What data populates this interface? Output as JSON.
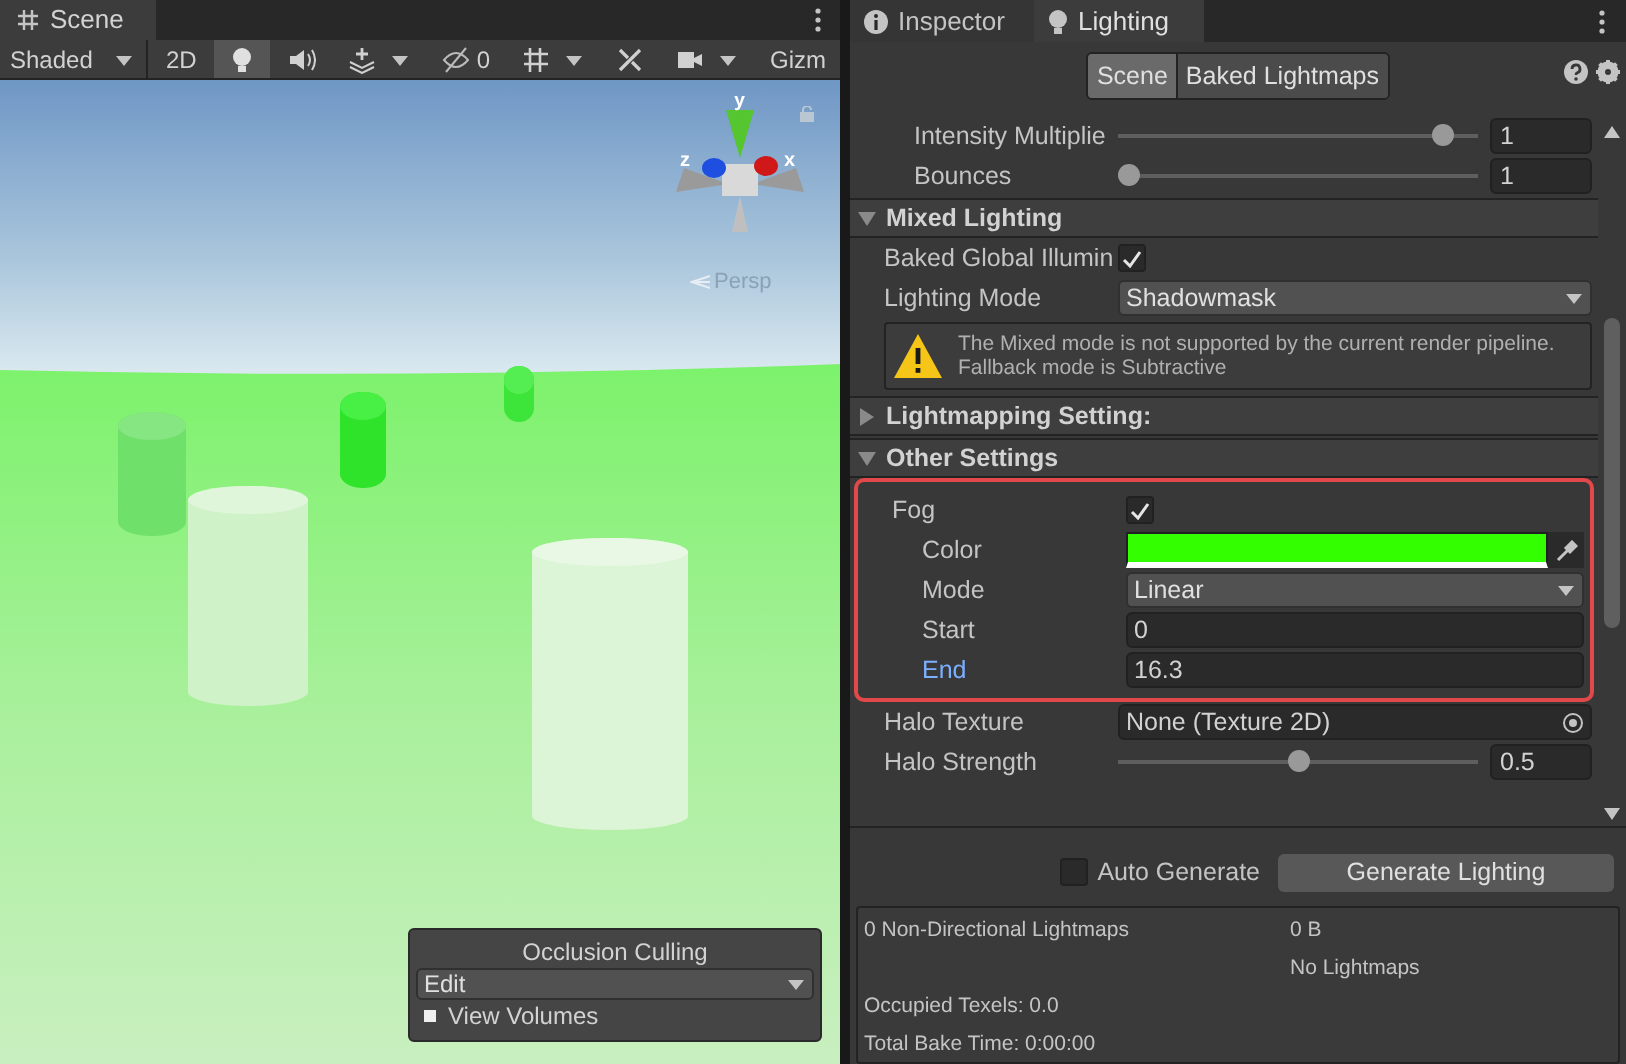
{
  "scene": {
    "tab": "Scene",
    "shading": "Shaded",
    "toolbar": [
      {
        "kind": "text",
        "label": "2D",
        "on": false
      },
      {
        "kind": "bulb",
        "on": true
      },
      {
        "kind": "speaker",
        "on": false
      },
      {
        "kind": "layers",
        "on": false,
        "caret": true
      },
      {
        "kind": "hidden",
        "label": "0",
        "on": false
      },
      {
        "kind": "grid",
        "on": false,
        "caret": true
      },
      {
        "kind": "tools",
        "on": false
      },
      {
        "kind": "camera",
        "on": false,
        "caret": true
      },
      {
        "kind": "text",
        "label": "Gizm",
        "on": false
      }
    ],
    "gizmo": {
      "y": "y",
      "x": "x",
      "z": "z"
    },
    "projection": "Persp",
    "occlusion": {
      "title": "Occlusion Culling",
      "mode": "Edit",
      "view_volumes": {
        "label": "View Volumes",
        "checked": true
      }
    }
  },
  "lighting": {
    "tabs": [
      {
        "label": "Inspector",
        "selected": false
      },
      {
        "label": "Lighting",
        "selected": true
      }
    ],
    "subtabs": [
      {
        "label": "Scene",
        "selected": true
      },
      {
        "label": "Baked Lightmaps",
        "selected": false
      }
    ],
    "rows": [
      {
        "kind": "slider",
        "label": "Intensity Multiplie",
        "indent": true,
        "level": 0.93,
        "value": "1"
      },
      {
        "kind": "slider",
        "label": "Bounces",
        "indent": true,
        "level": 0,
        "value": "1"
      },
      {
        "kind": "section",
        "label": "Mixed Lighting",
        "expanded": true
      },
      {
        "kind": "checkbox",
        "label": "Baked Global Illumin",
        "checked": true
      },
      {
        "kind": "dropdown",
        "label": "Lighting Mode",
        "value": "Shadowmask"
      },
      {
        "kind": "warning",
        "lines": [
          "The Mixed mode is not supported by the current render pipeline.",
          "Fallback mode is Subtractive"
        ]
      },
      {
        "kind": "section",
        "label": "Lightmapping Setting:",
        "expanded": false
      },
      {
        "kind": "section",
        "label": "Other Settings",
        "expanded": true
      },
      {
        "kind": "highlight",
        "children": [
          {
            "kind": "checkbox",
            "label": "Fog",
            "checked": true
          },
          {
            "kind": "color",
            "label": "Color",
            "indent": true,
            "color": "#33ff00"
          },
          {
            "kind": "dropdown",
            "label": "Mode",
            "indent": true,
            "value": "Linear"
          },
          {
            "kind": "field",
            "label": "Start",
            "indent": true,
            "value": "0"
          },
          {
            "kind": "field",
            "label": "End",
            "indent": true,
            "value": "16.3",
            "focused": true
          }
        ]
      },
      {
        "kind": "object",
        "label": "Halo Texture",
        "value": "None (Texture 2D)"
      },
      {
        "kind": "slider",
        "label": "Halo Strength",
        "level": 0.5,
        "value": "0.5"
      }
    ],
    "auto_generate": {
      "label": "Auto Generate",
      "checked": false
    },
    "generate": "Generate Lighting",
    "stats": {
      "left": [
        "0 Non-Directional Lightmaps",
        "Occupied Texels: 0.0",
        "Total Bake Time: 0:00:00"
      ],
      "right": [
        "0 B",
        "No Lightmaps"
      ]
    }
  }
}
